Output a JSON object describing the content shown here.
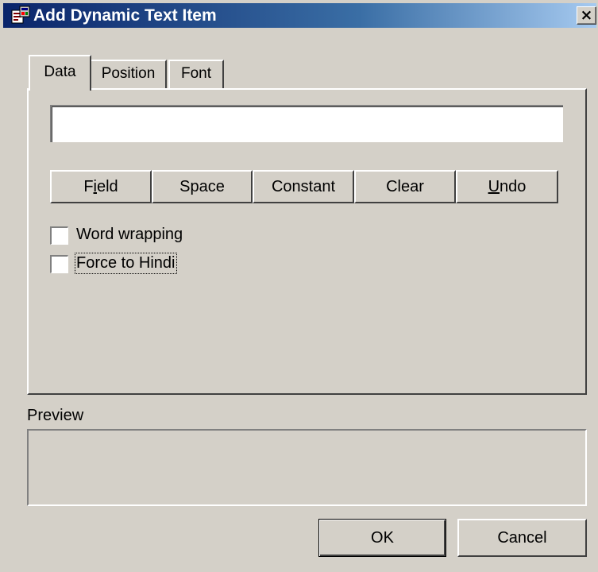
{
  "window": {
    "title": "Add Dynamic Text Item",
    "close_glyph": "×",
    "icon": "app-document-icon"
  },
  "tabs": [
    {
      "label": "Data",
      "selected": true
    },
    {
      "label": "Position",
      "selected": false
    },
    {
      "label": "Font",
      "selected": false
    }
  ],
  "data_tab": {
    "expression_value": "",
    "buttons": {
      "field": {
        "pre": "F",
        "mnemonic": "i",
        "post": "eld"
      },
      "space": "Space",
      "constant": "Constant",
      "clear": "Clear",
      "undo": {
        "pre": "",
        "mnemonic": "U",
        "post": "ndo"
      }
    },
    "checkboxes": {
      "word_wrapping": {
        "label": "Word wrapping",
        "checked": false
      },
      "force_to_hindi": {
        "label": "Force to Hindi",
        "checked": false
      }
    }
  },
  "preview": {
    "label": "Preview",
    "text": ""
  },
  "footer": {
    "ok_label": "OK",
    "cancel_label": "Cancel"
  },
  "colors": {
    "face": "#d4d0c8",
    "title_start": "#0a246a",
    "title_end": "#a6caf0"
  }
}
